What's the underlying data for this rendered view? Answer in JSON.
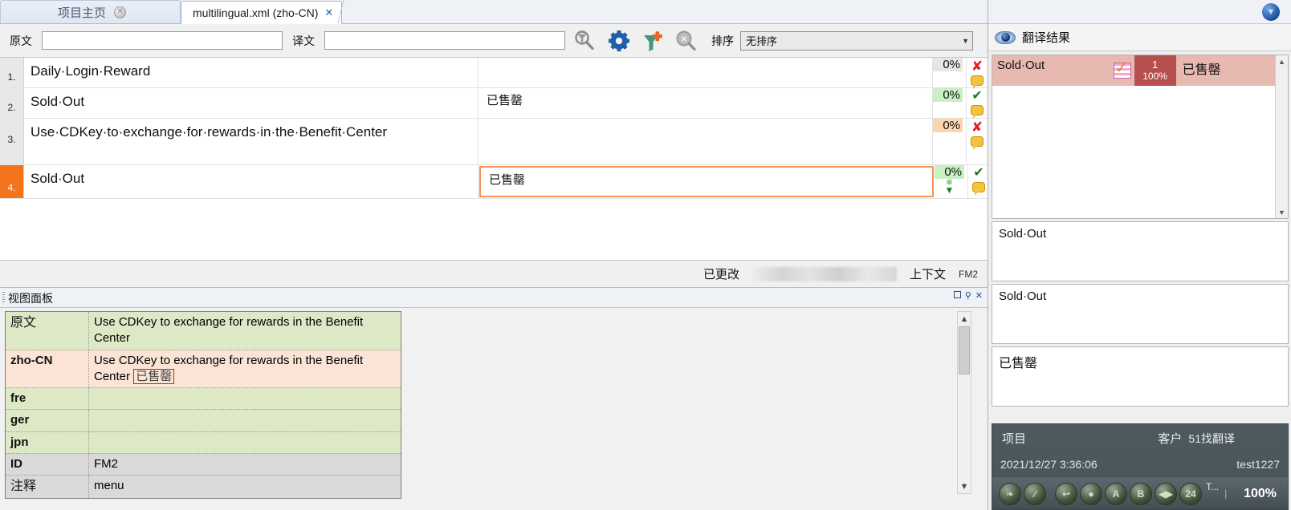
{
  "tabs": [
    {
      "label": "项目主页",
      "active": false,
      "close_icon": "close-circle-icon"
    },
    {
      "label": "multilingual.xml (zho-CN)",
      "active": true,
      "close_icon": "close-x-icon"
    }
  ],
  "filterbar": {
    "source_label": "原文",
    "source_value": "",
    "source_placeholder": "",
    "target_label": "译文",
    "target_value": "",
    "target_placeholder": "",
    "buttons": [
      {
        "name": "filter-search-icon",
        "title": "搜索"
      },
      {
        "name": "settings-gear-icon",
        "title": "设置"
      },
      {
        "name": "add-filter-icon",
        "title": "添加筛选"
      },
      {
        "name": "clear-search-icon",
        "title": "清除"
      }
    ],
    "sort_label": "排序",
    "sort_value": "无排序"
  },
  "grid": {
    "rows": [
      {
        "num": "1.",
        "source": "Daily·Login·Reward",
        "target": "",
        "pct": "0%",
        "pct_style": "grey",
        "status": "x",
        "selected": false,
        "editing": false
      },
      {
        "num": "2.",
        "source": "Sold·Out",
        "target": "已售罄",
        "pct": "0%",
        "pct_style": "green",
        "status": "check",
        "selected": false,
        "editing": false
      },
      {
        "num": "3.",
        "source": "Use·CDKey·to·exchange·for·rewards·in·the·Benefit·Center",
        "target": "",
        "pct": "0%",
        "pct_style": "orange",
        "status": "x",
        "selected": false,
        "editing": false
      },
      {
        "num": "4.",
        "source": "Sold·Out",
        "target": "已售罄",
        "pct": "0%",
        "pct_style": "green",
        "status": "check",
        "selected": true,
        "editing": true
      }
    ]
  },
  "statusbar": {
    "changed_label": "已更改",
    "redacted": "",
    "context_label": "上下文",
    "id_value": "FM2"
  },
  "view_panel": {
    "title": "视图面板",
    "window_buttons": [
      "restore-icon",
      "pin-icon",
      "close-icon"
    ],
    "rows": [
      {
        "key": "原文",
        "value": "Use CDKey to exchange for rewards in the Benefit Center",
        "tag": "",
        "style": "green",
        "key_cjk": true
      },
      {
        "key": "zho-CN",
        "value": "Use CDKey to exchange for rewards in the Benefit Center",
        "tag": "已售罄",
        "style": "peach",
        "key_cjk": false
      },
      {
        "key": "fre",
        "value": "",
        "tag": "",
        "style": "green",
        "key_cjk": false
      },
      {
        "key": "ger",
        "value": "",
        "tag": "",
        "style": "green",
        "key_cjk": false
      },
      {
        "key": "jpn",
        "value": "",
        "tag": "",
        "style": "green",
        "key_cjk": false
      },
      {
        "key": "ID",
        "value": "FM2",
        "tag": "",
        "style": "grey",
        "key_cjk": false
      },
      {
        "key": "注释",
        "value": "menu",
        "tag": "",
        "style": "grey",
        "key_cjk": true
      }
    ]
  },
  "right_panel": {
    "globe_icon": "globe-icon",
    "results_title": "翻译结果",
    "eye_icon": "eye-icon",
    "tm_matches": [
      {
        "source": "Sold·Out",
        "icon": "tm-match-icon",
        "index": "1",
        "score": "100%",
        "target": "已售罄"
      }
    ],
    "segments": [
      {
        "text": "Sold·Out",
        "cjk": false
      },
      {
        "text": "Sold·Out",
        "cjk": false
      },
      {
        "text": "已售罄",
        "cjk": true
      }
    ],
    "info": {
      "project_label": "项目",
      "project_value": "",
      "customer_label": "客户",
      "customer_value": "51找翻译",
      "timestamp": "2021/12/27 3:36:06",
      "user": "test1227",
      "toolbar_icons": [
        "globe-orb-icon",
        "slash-orb-icon",
        "back-orb-icon",
        "dot-orb-icon",
        "a-orb-icon",
        "b-orb-icon",
        "play-orb-icon",
        "24-orb-icon"
      ],
      "t_label": "T...",
      "zoom": "100%"
    }
  }
}
